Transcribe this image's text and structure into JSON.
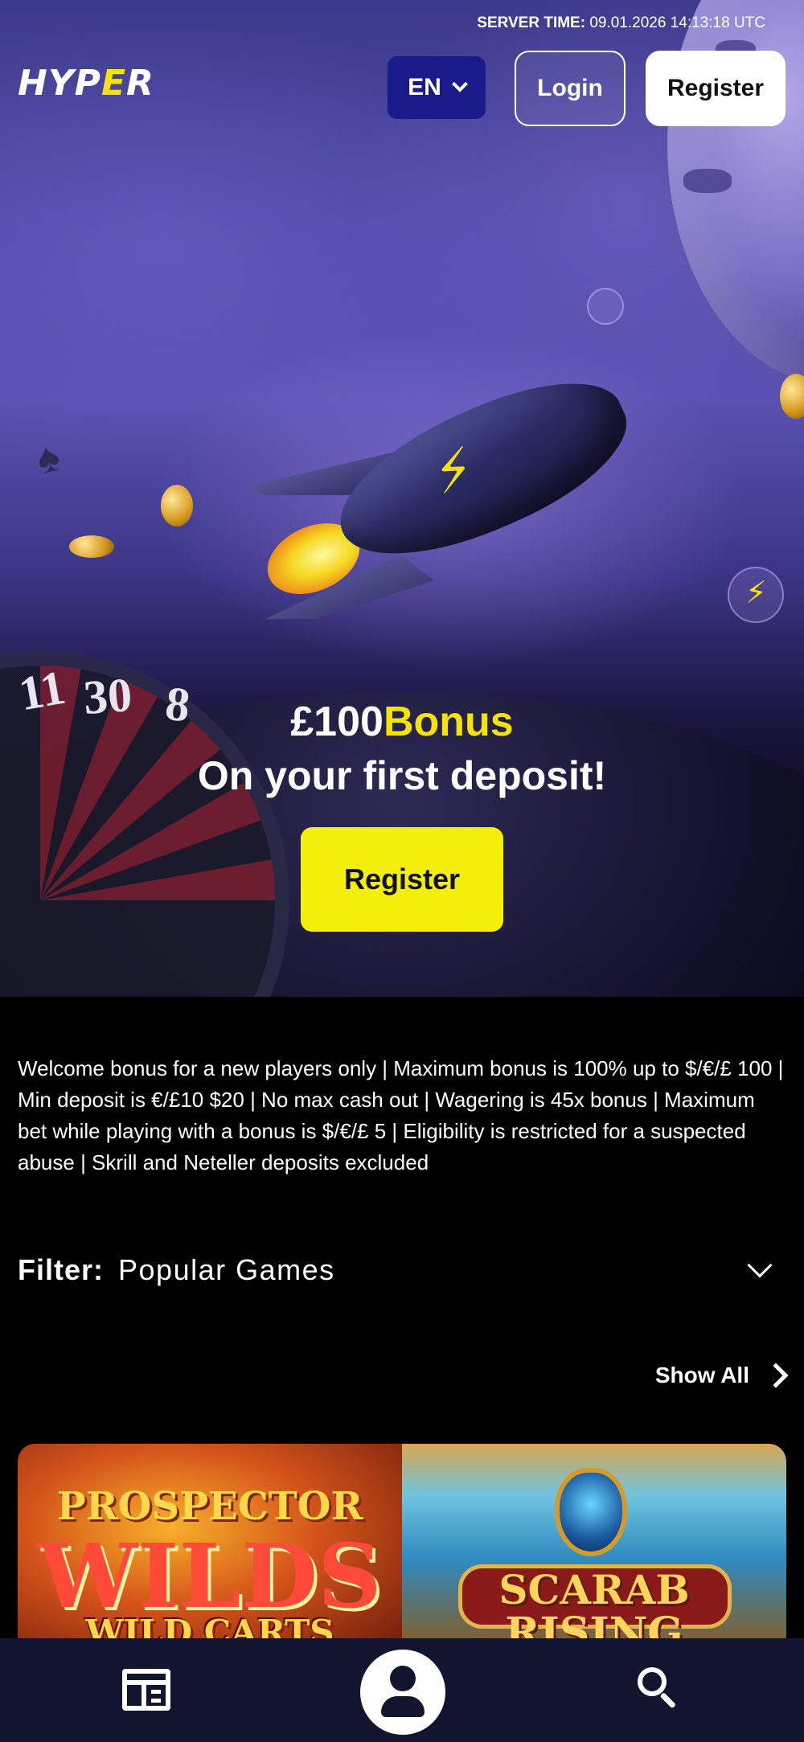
{
  "header": {
    "server_time_label": "SERVER TIME:",
    "server_time_value": "09.01.2026 14:13:18 UTC",
    "logo_text_a": "HYP",
    "logo_text_b": "E",
    "logo_text_c": "R",
    "language": "EN",
    "login_label": "Login",
    "register_label": "Register"
  },
  "promo": {
    "amount": "£100",
    "bonus_word": "Bonus",
    "subtitle": "On your first deposit!",
    "register_label": "Register"
  },
  "terms": "Welcome bonus for a new players only | Maximum bonus is 100% up to $/€/£ 100 | Min deposit is €/£10 $20 | No max cash out | Wagering is 45x bonus | Maximum bet while playing with a bonus is $/€/£ 5 | Eligibility is restricted for a suspected abuse | Skrill and Neteller deposits excluded",
  "hero_art": {
    "roulette_numbers": [
      "11",
      "30",
      "8"
    ]
  },
  "filter": {
    "label": "Filter:",
    "value": "Popular Games"
  },
  "games_section": {
    "show_all_label": "Show All",
    "games": [
      {
        "title_line1": "PROSPECTOR",
        "title_line2": "WILDS",
        "title_line3": "WILD CARTS"
      },
      {
        "title_line1": "SCARAB",
        "title_line2": "RISING"
      }
    ]
  },
  "colors": {
    "accent_yellow": "#f3ee0a",
    "lang_button_bg": "#1a1a8a",
    "bottom_nav_bg": "#131530"
  },
  "icons": {
    "nav_left": "news-icon",
    "nav_center": "profile-icon",
    "nav_right": "search-icon"
  }
}
